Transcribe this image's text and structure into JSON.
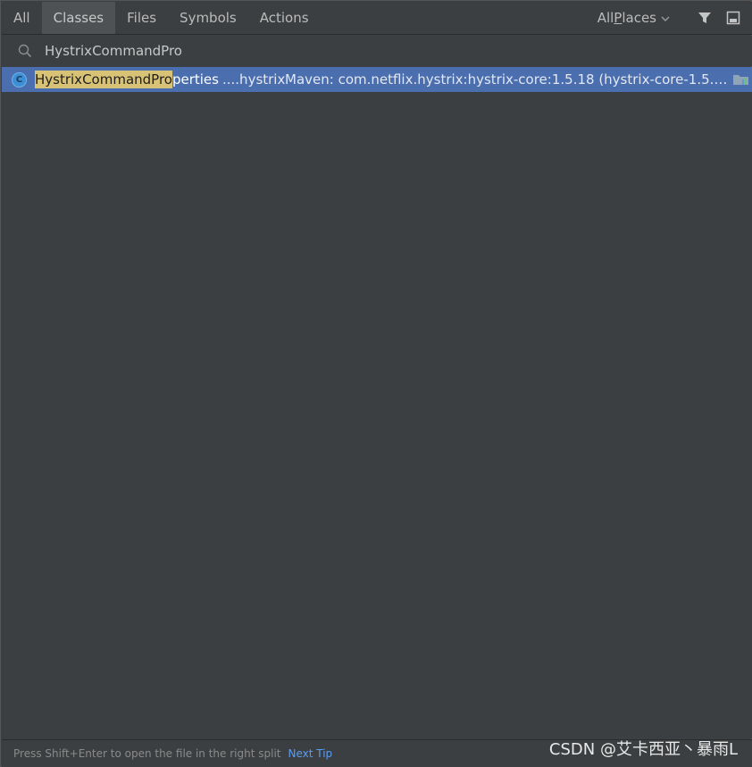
{
  "tabs": [
    {
      "label": "All"
    },
    {
      "label": "Classes"
    },
    {
      "label": "Files"
    },
    {
      "label": "Symbols"
    },
    {
      "label": "Actions"
    }
  ],
  "active_tab": "Classes",
  "scope": {
    "label_prefix": "All ",
    "label_mnemonic": "P",
    "label_rest": "laces"
  },
  "search": {
    "value": "HystrixCommandPro"
  },
  "results": [
    {
      "icon_letter": "C",
      "name_match": "HystrixCommandPro",
      "name_rest": "perties",
      "package": "....hystrix",
      "location": "Maven: com.netflix.hystrix:hystrix-core:1.5.18 (hystrix-core-1.5.18.ja..."
    }
  ],
  "footer": {
    "hint": "Press Shift+Enter to open the file in the right split",
    "next_tip": "Next Tip"
  },
  "watermark": "CSDN @艾卡西亚丶暴雨L",
  "colors": {
    "background": "#3c3f41",
    "selection": "#4b6eaf",
    "match_highlight": "#d8c276",
    "link": "#589df6"
  }
}
